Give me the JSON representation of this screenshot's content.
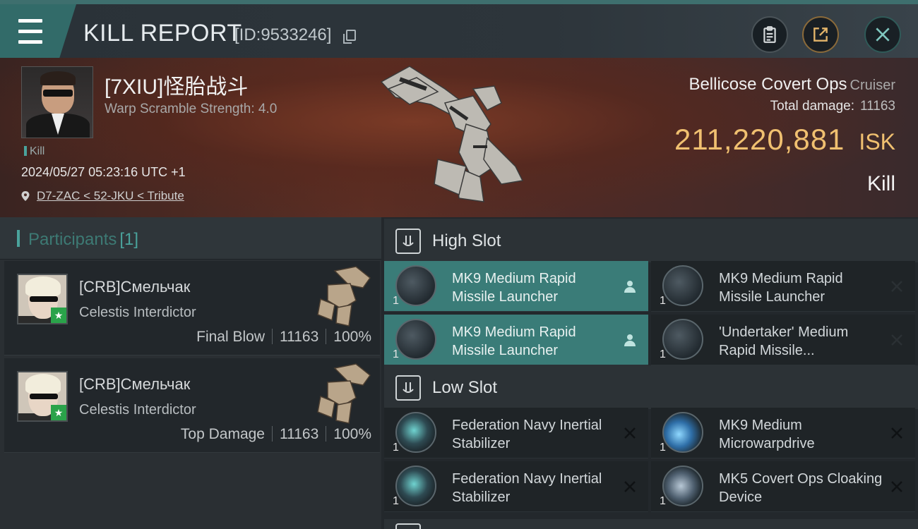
{
  "header": {
    "title": "KILL REPORT",
    "report_id": "[ID:9533246]"
  },
  "victim": {
    "name": "[7XIU]怪胎战斗",
    "warp_scramble": "Warp Scramble Strength: 4.0",
    "tag": "Kill",
    "datetime": "2024/05/27 05:23:16 UTC +1",
    "location": "D7-ZAC < 52-JKU < Tribute",
    "ship_name": "Bellicose Covert Ops",
    "ship_class": "Cruiser",
    "total_damage_label": "Total damage:",
    "total_damage": "11163",
    "isk_value": "211,220,881",
    "isk_unit": "ISK",
    "kill_type": "Kill"
  },
  "participants": {
    "title": "Participants",
    "count": "[1]",
    "items": [
      {
        "name": "[CRB]Смельчак",
        "ship": "Celestis Interdictor",
        "role": "Final Blow",
        "damage": "11163",
        "percent": "100%"
      },
      {
        "name": "[CRB]Смельчак",
        "ship": "Celestis Interdictor",
        "role": "Top Damage",
        "damage": "11163",
        "percent": "100%"
      }
    ]
  },
  "fitting": {
    "high_slot": {
      "title": "High Slot",
      "modules": [
        {
          "qty": "1",
          "name": "MK9 Medium Rapid Missile Launcher",
          "active": true,
          "action_icon": "pilot-icon"
        },
        {
          "qty": "1",
          "name": "MK9 Medium Rapid Missile Launcher",
          "active": false,
          "action_icon": "destroyed-icon"
        },
        {
          "qty": "1",
          "name": "MK9 Medium Rapid Missile Launcher",
          "active": true,
          "action_icon": "pilot-icon"
        },
        {
          "qty": "1",
          "name": "'Undertaker' Medium Rapid Missile...",
          "active": false,
          "action_icon": "destroyed-icon"
        }
      ]
    },
    "low_slot": {
      "title": "Low Slot",
      "modules": [
        {
          "qty": "1",
          "name": "Federation Navy Inertial Stabilizer",
          "active": false,
          "action_icon": "destroyed-icon"
        },
        {
          "qty": "1",
          "name": "MK9 Medium Microwarpdrive",
          "active": false,
          "action_icon": "destroyed-icon"
        },
        {
          "qty": "1",
          "name": "Federation Navy Inertial Stabilizer",
          "active": false,
          "action_icon": "destroyed-icon"
        },
        {
          "qty": "1",
          "name": "MK5 Covert Ops Cloaking Device",
          "active": false,
          "action_icon": "destroyed-icon"
        }
      ]
    }
  },
  "colors": {
    "accent": "#4aa39c",
    "active_module": "#3a7c78",
    "isk": "#f0c070",
    "rookie_badge": "#2aa34a"
  }
}
